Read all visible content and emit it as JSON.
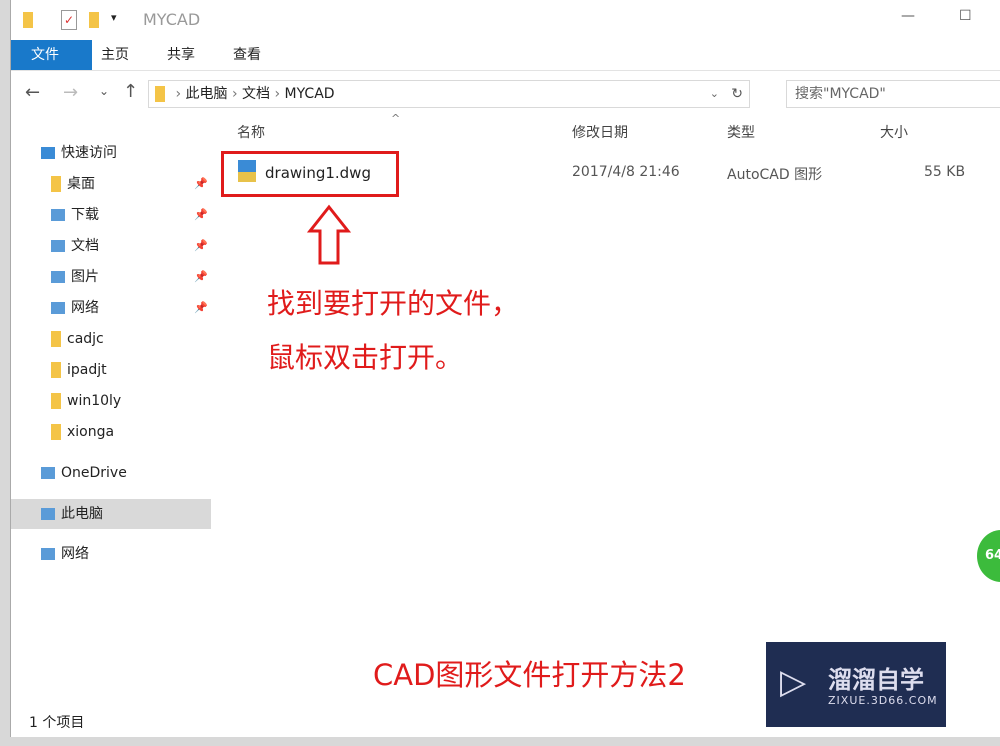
{
  "window": {
    "title": "MYCAD",
    "minimize": "—",
    "maximize": "☐"
  },
  "ribbon": {
    "tabs": [
      "文件",
      "主页",
      "共享",
      "查看"
    ]
  },
  "address": {
    "path": [
      "此电脑",
      "文档",
      "MYCAD"
    ],
    "search_placeholder": "搜索\"MYCAD\""
  },
  "nav": {
    "items": [
      {
        "label": "快速访问",
        "icon": "star-icon",
        "pinned": false
      },
      {
        "label": "桌面",
        "icon": "folder-icon",
        "pinned": true
      },
      {
        "label": "下载",
        "icon": "download-icon",
        "pinned": true
      },
      {
        "label": "文档",
        "icon": "document-icon",
        "pinned": true
      },
      {
        "label": "图片",
        "icon": "picture-icon",
        "pinned": true
      },
      {
        "label": "网络",
        "icon": "network-icon",
        "pinned": true
      },
      {
        "label": "cadjc",
        "icon": "folder-icon",
        "pinned": false
      },
      {
        "label": "ipadjt",
        "icon": "folder-icon",
        "pinned": false
      },
      {
        "label": "win10ly",
        "icon": "folder-icon",
        "pinned": false
      },
      {
        "label": "xionga",
        "icon": "folder-icon",
        "pinned": false
      },
      {
        "label": "OneDrive",
        "icon": "cloud-icon",
        "pinned": false
      },
      {
        "label": "此电脑",
        "icon": "computer-icon",
        "pinned": false,
        "selected": true
      },
      {
        "label": "网络",
        "icon": "network-icon",
        "pinned": false
      }
    ]
  },
  "columns": [
    "名称",
    "修改日期",
    "类型",
    "大小"
  ],
  "files": [
    {
      "name": "drawing1.dwg",
      "date": "2017/4/8 21:46",
      "type": "AutoCAD 图形",
      "size": "55 KB"
    }
  ],
  "annotation": {
    "line1": "找到要打开的文件，",
    "line2": "鼠标双击打开。",
    "caption": "CAD图形文件打开方法2"
  },
  "watermark": {
    "name": "溜溜自学",
    "url": "ZIXUE.3D66.COM"
  },
  "badge": "64",
  "status": "1 个项目",
  "colors": {
    "accent": "#1979ca",
    "annotation": "#e01b1b",
    "watermark_bg": "#1f2d52"
  }
}
